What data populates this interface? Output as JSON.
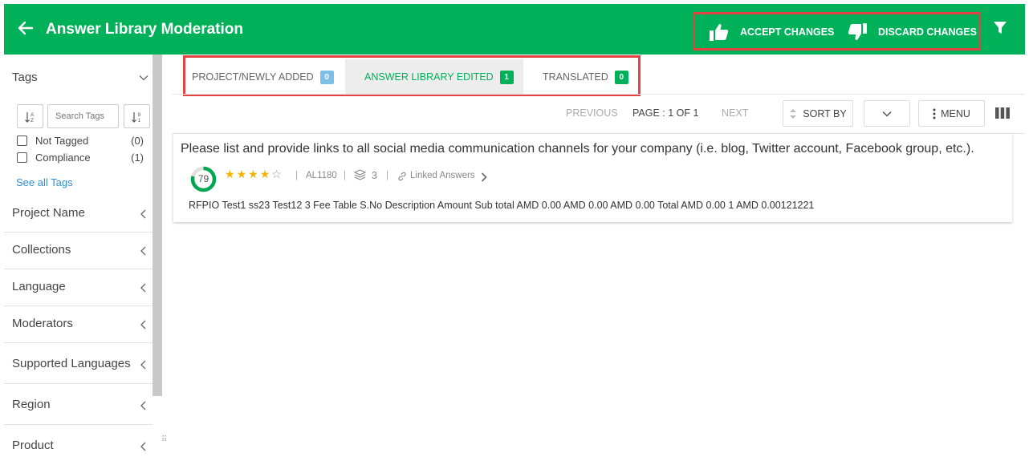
{
  "header": {
    "title": "Answer Library Moderation",
    "accept_label": "ACCEPT CHANGES",
    "discard_label": "DISCARD CHANGES",
    "accent": "#00b159"
  },
  "sidebar": {
    "tags_title": "Tags",
    "search_placeholder": "Search Tags",
    "tags": [
      {
        "label": "Not Tagged",
        "count": "(0)"
      },
      {
        "label": "Compliance",
        "count": "(1)"
      }
    ],
    "see_all": "See all Tags",
    "facets": [
      "Project Name",
      "Collections",
      "Language",
      "Moderators",
      "Supported Languages",
      "Region",
      "Product"
    ]
  },
  "tabs": [
    {
      "label": "PROJECT/NEWLY ADDED",
      "count": "0",
      "badge_color": "#7cc0ea"
    },
    {
      "label": "ANSWER LIBRARY EDITED",
      "count": "1",
      "badge_color": "#00b159"
    },
    {
      "label": "TRANSLATED",
      "count": "0",
      "badge_color": "#00b159"
    }
  ],
  "toolbar": {
    "previous": "PREVIOUS",
    "page": "PAGE : 1 OF 1",
    "next": "NEXT",
    "sort_by": "SORT BY",
    "menu": "MENU"
  },
  "card": {
    "question": "Please list and provide links to all social media communication channels for your company (i.e. blog, Twitter account, Facebook group, etc.).",
    "score": "79",
    "rating": 4,
    "rating_max": 5,
    "id": "AL1180",
    "stack_count": "3",
    "linked_answers": "Linked Answers",
    "answer": "RFPIO Test1 ss23 Test12 3 Fee Table S.No Description Amount Sub total AMD 0.00 AMD 0.00 AMD 0.00 Total AMD 0.00 1 AMD 0.00121221"
  }
}
